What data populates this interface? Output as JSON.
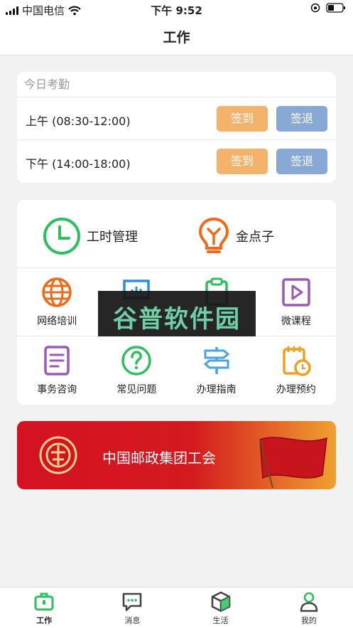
{
  "status_bar": {
    "carrier": "中国电信",
    "time": "下午 9:52"
  },
  "nav": {
    "title": "工作"
  },
  "attendance": {
    "title": "今日考勤",
    "rows": [
      {
        "label": "上午 (08:30-12:00)",
        "checkin": "签到",
        "checkout": "签退"
      },
      {
        "label": "下午 (14:00-18:00)",
        "checkin": "签到",
        "checkout": "签退"
      }
    ]
  },
  "menu": {
    "big": [
      {
        "label": "工时管理",
        "icon": "clock-icon"
      },
      {
        "label": "金点子",
        "icon": "lightbulb-icon"
      }
    ],
    "row1": [
      {
        "label": "网络培训",
        "icon": "globe-icon"
      },
      {
        "label": "",
        "icon": "presentation-icon"
      },
      {
        "label": "",
        "icon": "clipboard-icon"
      },
      {
        "label": "微课程",
        "icon": "play-icon"
      }
    ],
    "row2": [
      {
        "label": "事务咨询",
        "icon": "document-icon"
      },
      {
        "label": "常见问题",
        "icon": "question-icon"
      },
      {
        "label": "办理指南",
        "icon": "signpost-icon"
      },
      {
        "label": "办理预约",
        "icon": "calendar-clock-icon"
      }
    ]
  },
  "banner": {
    "text": "中国邮政集团工会"
  },
  "watermark": {
    "text": "谷普软件园"
  },
  "tabs": [
    {
      "label": "工作",
      "icon": "briefcase-icon",
      "active": true
    },
    {
      "label": "消息",
      "icon": "chat-icon",
      "active": false
    },
    {
      "label": "生活",
      "icon": "cube-icon",
      "active": false
    },
    {
      "label": "我的",
      "icon": "person-icon",
      "active": false
    }
  ],
  "colors": {
    "checkin": "#f4b36a",
    "checkout": "#88a9d6",
    "accent_green": "#2fbf5f",
    "banner_red": "#d41222"
  }
}
